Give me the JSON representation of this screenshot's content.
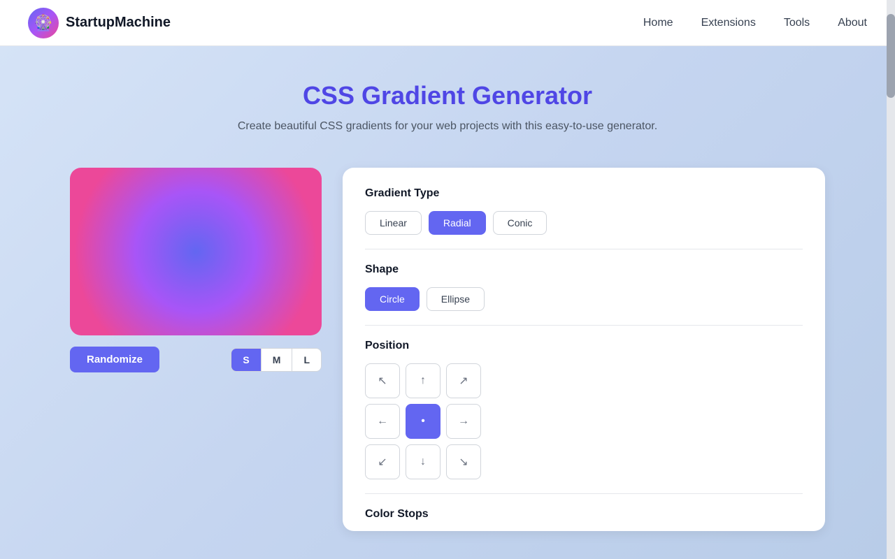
{
  "header": {
    "logo_emoji": "🎡",
    "logo_text": "StartupMachine",
    "nav": [
      {
        "label": "Home",
        "id": "nav-home"
      },
      {
        "label": "Extensions",
        "id": "nav-extensions"
      },
      {
        "label": "Tools",
        "id": "nav-tools"
      },
      {
        "label": "About",
        "id": "nav-about"
      }
    ]
  },
  "hero": {
    "title": "CSS Gradient Generator",
    "subtitle": "Create beautiful CSS gradients for your web projects with this easy-to-use generator."
  },
  "controls": {
    "gradient_type_label": "Gradient Type",
    "gradient_types": [
      {
        "label": "Linear",
        "active": false
      },
      {
        "label": "Radial",
        "active": true
      },
      {
        "label": "Conic",
        "active": false
      }
    ],
    "shape_label": "Shape",
    "shapes": [
      {
        "label": "Circle",
        "active": true
      },
      {
        "label": "Ellipse",
        "active": false
      }
    ],
    "position_label": "Position",
    "positions": [
      {
        "symbol": "↖",
        "row": 0,
        "col": 0,
        "active": false
      },
      {
        "symbol": "↑",
        "row": 0,
        "col": 1,
        "active": false
      },
      {
        "symbol": "↗",
        "row": 0,
        "col": 2,
        "active": false
      },
      {
        "symbol": "←",
        "row": 1,
        "col": 0,
        "active": false
      },
      {
        "symbol": "•",
        "row": 1,
        "col": 1,
        "active": true
      },
      {
        "symbol": "→",
        "row": 1,
        "col": 2,
        "active": false
      },
      {
        "symbol": "↙",
        "row": 2,
        "col": 0,
        "active": false
      },
      {
        "symbol": "↓",
        "row": 2,
        "col": 1,
        "active": false
      },
      {
        "symbol": "↘",
        "row": 2,
        "col": 2,
        "active": false
      }
    ],
    "color_stops_label": "Color Stops",
    "color_stop_swatch_color": "#6366f1"
  },
  "preview": {
    "randomize_label": "Randomize",
    "size_buttons": [
      {
        "label": "S",
        "active": true
      },
      {
        "label": "M",
        "active": false
      },
      {
        "label": "L",
        "active": false
      }
    ]
  }
}
